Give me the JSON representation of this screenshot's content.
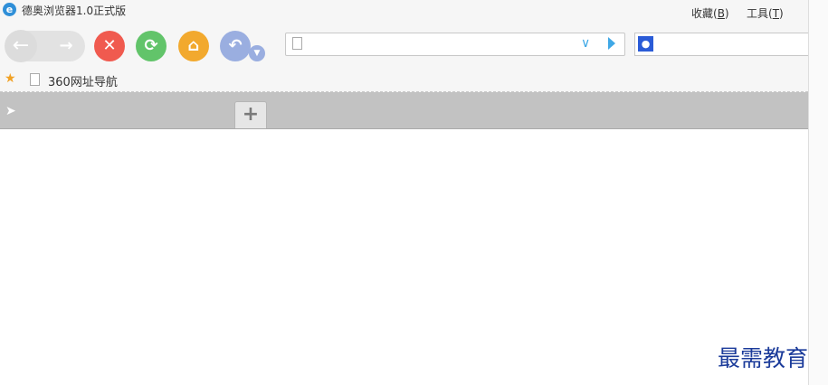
{
  "window": {
    "title": "德奥浏览器1.0正式版",
    "app_icon_glyph": "e"
  },
  "menu": {
    "favorites": {
      "label": "收藏(",
      "key": "B",
      "close": ")"
    },
    "tools": {
      "label": "工具(",
      "key": "T",
      "close": ")"
    }
  },
  "toolbar": {
    "back_icon": "back-arrow-icon",
    "forward_icon": "forward-arrow-icon",
    "stop_icon": "close-icon",
    "refresh_icon": "refresh-icon",
    "home_icon": "home-icon",
    "undo_icon": "undo-icon",
    "colors": {
      "stop": "#f05a4f",
      "refresh": "#62c46a",
      "home": "#f2a92e",
      "undo": "#9aaee0",
      "accent": "#3fa8e6"
    }
  },
  "address_bar": {
    "value": "",
    "placeholder": ""
  },
  "search_bar": {
    "value": "",
    "placeholder": "",
    "engine_icon": "baidu-paw-icon"
  },
  "favorites_bar": {
    "items": [
      {
        "label": "360网址导航"
      }
    ]
  },
  "tabs": {
    "new_tab_icon": "plus-icon"
  },
  "watermark": {
    "text": "最需教育"
  }
}
